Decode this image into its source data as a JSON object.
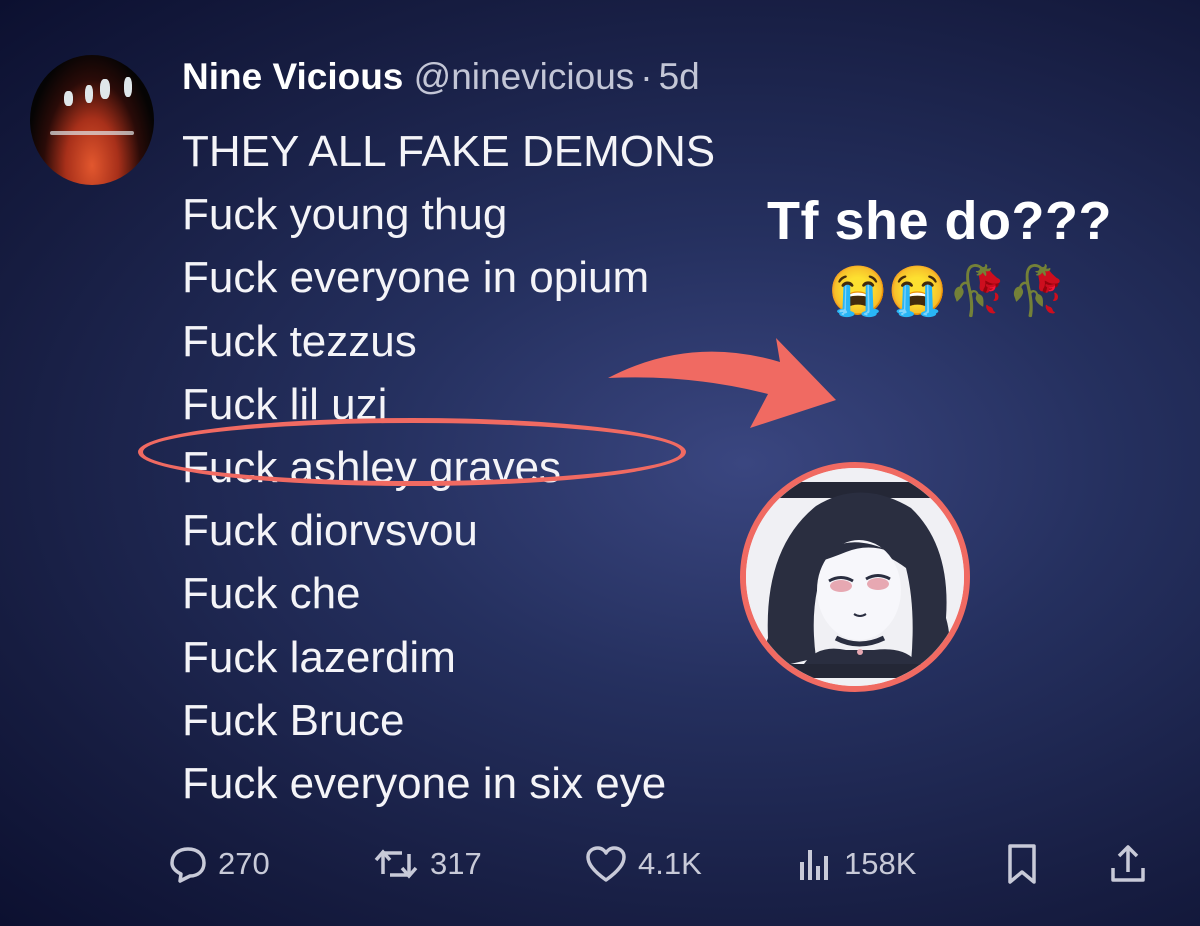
{
  "tweet": {
    "author_name": "Nine Vicious",
    "handle": "@ninevicious",
    "separator": "·",
    "time": "5d",
    "lines": [
      "THEY ALL FAKE DEMONS",
      "Fuck young thug",
      "Fuck everyone in opium",
      "Fuck tezzus",
      "Fuck lil uzi",
      "Fuck ashley graves",
      "Fuck diorvsvou",
      "Fuck che",
      "Fuck lazerdim",
      "Fuck Bruce",
      "Fuck everyone in six eye"
    ],
    "highlighted_line_index": 5
  },
  "annotation": {
    "text": "Tf she do???",
    "emojis": "😭😭🥀🥀",
    "accent_color": "#f06a62"
  },
  "actions": {
    "reply": {
      "icon": "reply-icon",
      "count": "270"
    },
    "retweet": {
      "icon": "retweet-icon",
      "count": "317"
    },
    "like": {
      "icon": "heart-icon",
      "count": "4.1K"
    },
    "views": {
      "icon": "views-icon",
      "count": "158K"
    },
    "bookmark": {
      "icon": "bookmark-icon"
    },
    "share": {
      "icon": "share-icon"
    }
  }
}
